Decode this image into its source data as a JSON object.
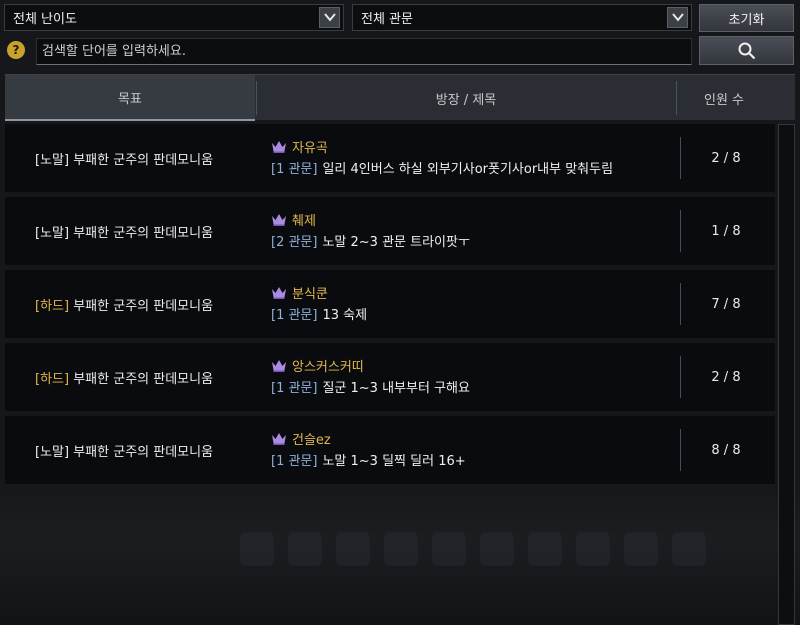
{
  "filters": {
    "difficulty": "전체 난이도",
    "stage": "전체 관문",
    "reset_label": "초기화"
  },
  "search": {
    "placeholder": "검색할 단어를 입력하세요.",
    "help_glyph": "?"
  },
  "header": {
    "goal": "목표",
    "title": "방장 / 제목",
    "count": "인원 수"
  },
  "colors": {
    "hard": "#e3b54b",
    "leader": "#e0b84e",
    "stage": "#8fb0d8",
    "crown": "#a98be0"
  },
  "rows": [
    {
      "difficulty": "[노말]",
      "difficulty_level": "normal",
      "goal": "부패한 군주의 판데모니움",
      "leader": "자유곡",
      "stage": "[1 관문]",
      "title": "일리 4인버스 하실 외부기사or폿기사or내부 맞춰두림",
      "count": "2 / 8"
    },
    {
      "difficulty": "[노말]",
      "difficulty_level": "normal",
      "goal": "부패한 군주의 판데모니움",
      "leader": "췌제",
      "stage": "[2 관문]",
      "title": "노말 2~3 관문 트라이팟ㅜ",
      "count": "1 / 8"
    },
    {
      "difficulty": "[하드]",
      "difficulty_level": "hard",
      "goal": "부패한 군주의 판데모니움",
      "leader": "분식쿤",
      "stage": "[1 관문]",
      "title": "13 숙제",
      "count": "7 / 8"
    },
    {
      "difficulty": "[하드]",
      "difficulty_level": "hard",
      "goal": "부패한 군주의 판데모니움",
      "leader": "앙스커스커띠",
      "stage": "[1 관문]",
      "title": "질군 1~3 내부부터 구해요",
      "count": "2 / 8"
    },
    {
      "difficulty": "[노말]",
      "difficulty_level": "normal",
      "goal": "부패한 군주의 판데모니움",
      "leader": "건슬ez",
      "stage": "[1 관문]",
      "title": "노말 1~3 딜찍 딜러  16+",
      "count": "8 / 8"
    }
  ]
}
